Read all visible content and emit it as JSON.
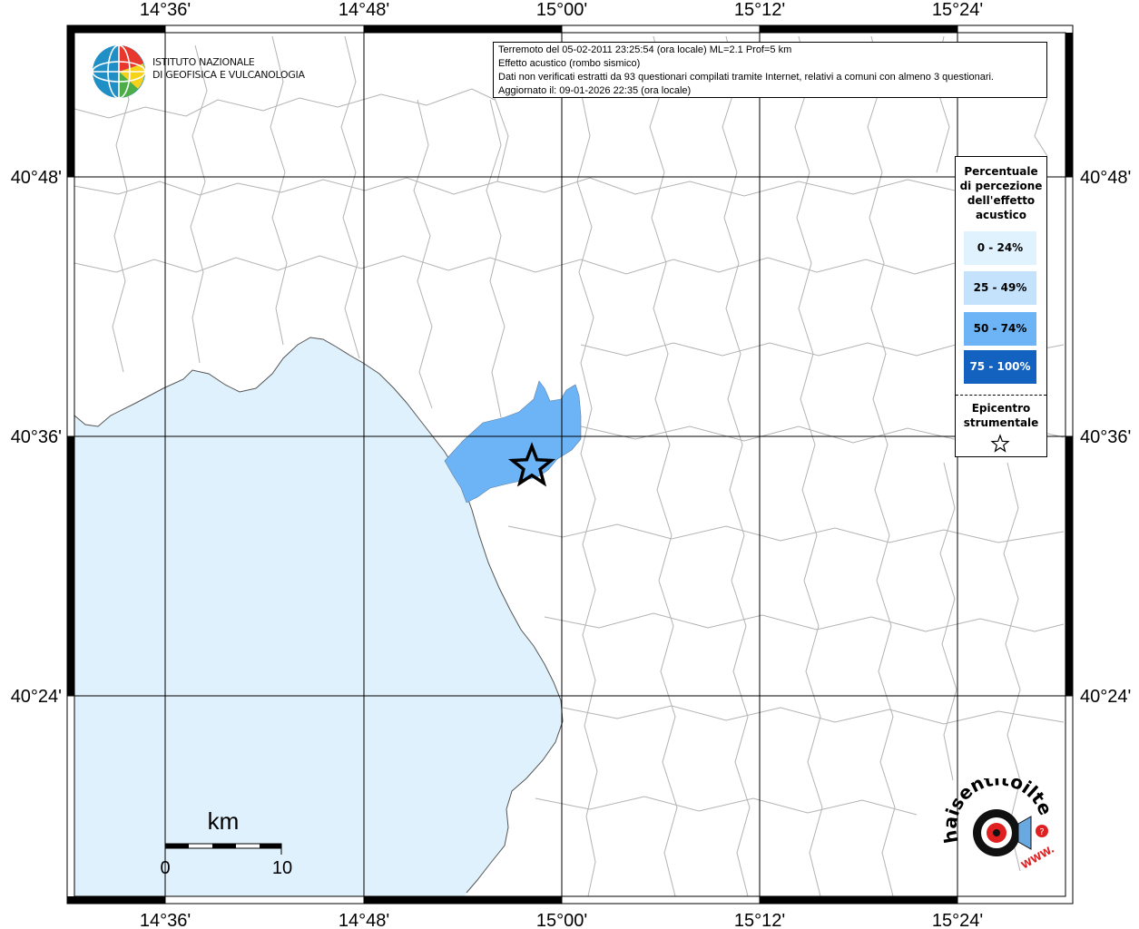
{
  "info": {
    "line1": "Terremoto del 05-02-2011 23:25:54 (ora locale) ML=2.1 Prof=5 km",
    "line2": "Effetto acustico (rombo sismico)",
    "line3": "Dati non verificati estratti da 93 questionari compilati tramite Internet, relativi a comuni con almeno 3 questionari.",
    "line4": "Aggiornato il: 09-01-2026 22:35 (ora locale)"
  },
  "logo": {
    "line1": "ISTITUTO NAZIONALE",
    "line2": "DI GEOFISICA E VULCANOLOGIA"
  },
  "site_logo": {
    "brand": "haisentitoilterremoto.it",
    "www": "WWW."
  },
  "axes": {
    "lon_ticks": [
      "14°36'",
      "14°48'",
      "15°00'",
      "15°12'",
      "15°24'"
    ],
    "lat_ticks": [
      "40°48'",
      "40°36'",
      "40°24'"
    ]
  },
  "legend": {
    "title_lines": [
      "Percentuale",
      "di percezione",
      "dell'effetto",
      "acustico"
    ],
    "classes": [
      {
        "label": "0 - 24%",
        "color": "#e0f2fd",
        "text_color": "#000000"
      },
      {
        "label": "25 - 49%",
        "color": "#c4e2fb",
        "text_color": "#000000"
      },
      {
        "label": "50 - 74%",
        "color": "#6cb4f6",
        "text_color": "#000000"
      },
      {
        "label": "75 - 100%",
        "color": "#1462c0",
        "text_color": "#ffffff"
      }
    ],
    "epicentre_lines": [
      "Epicentro",
      "strumentale"
    ]
  },
  "scalebar": {
    "unit": "km",
    "min_label": "0",
    "max_label": "10"
  },
  "colors": {
    "sea": "#dff1fc",
    "land": "#ffffff",
    "felt_area": "#6cb4f6",
    "borders": "#b3b3b3",
    "grid": "#000000"
  }
}
